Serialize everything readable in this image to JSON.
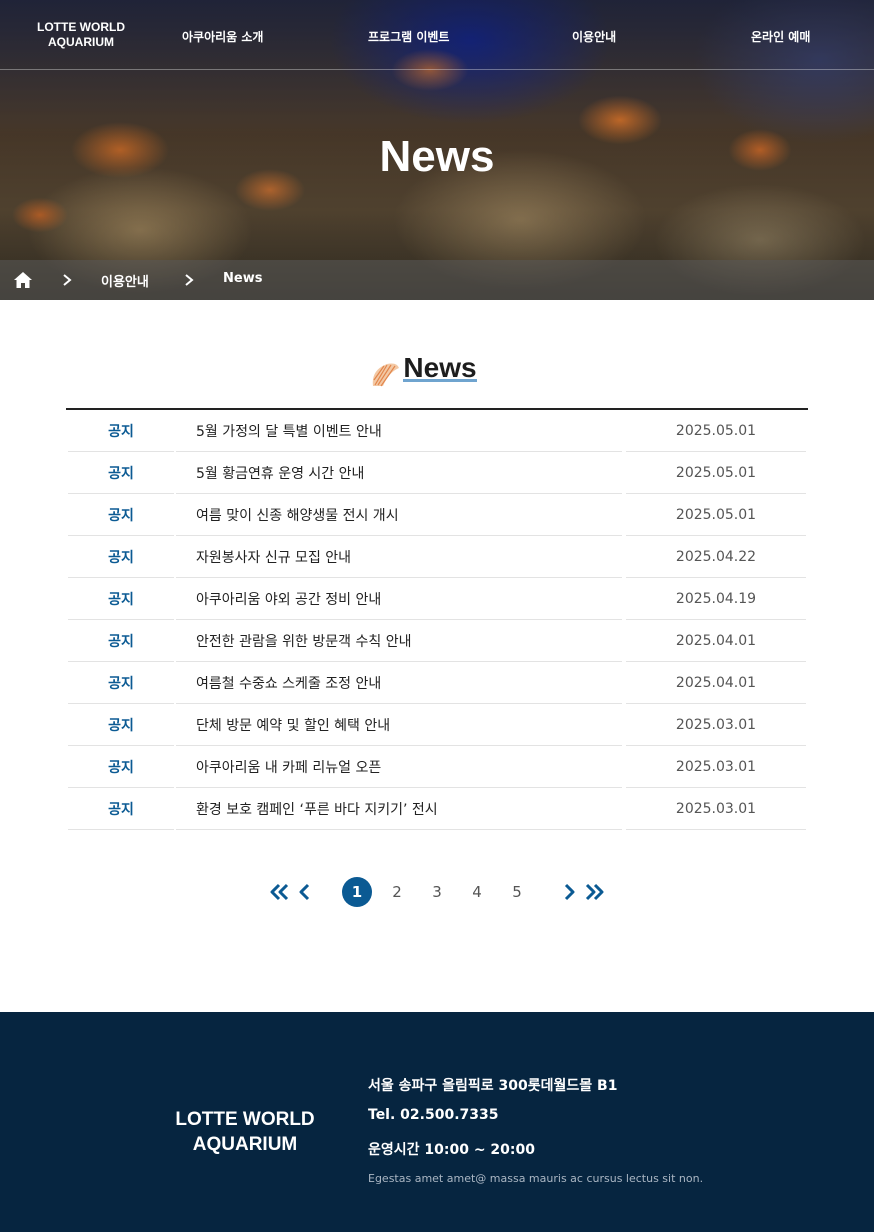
{
  "brand": {
    "logo_line1": "LOTTE WORLD",
    "logo_line2": "AQUARIUM"
  },
  "nav": {
    "items": [
      {
        "label": "아쿠아리움 소개"
      },
      {
        "label": "프로그램 이벤트"
      },
      {
        "label": "이용안내"
      },
      {
        "label": "온라인 예매"
      }
    ]
  },
  "hero": {
    "title": "News"
  },
  "breadcrumb": {
    "home_icon": "home-icon",
    "items": [
      "이용안내",
      "News"
    ]
  },
  "section": {
    "title": "News",
    "icon": "shell-icon"
  },
  "news": {
    "rows": [
      {
        "category": "공지",
        "title": "5월 가정의 달 특별 이벤트 안내",
        "date": "2025.05.01"
      },
      {
        "category": "공지",
        "title": "5월 황금연휴 운영 시간 안내",
        "date": "2025.05.01"
      },
      {
        "category": "공지",
        "title": "여름 맞이 신종 해양생물 전시 개시",
        "date": "2025.05.01"
      },
      {
        "category": "공지",
        "title": "자원봉사자 신규 모집 안내",
        "date": "2025.04.22"
      },
      {
        "category": "공지",
        "title": "아쿠아리움 야외 공간 정비 안내",
        "date": "2025.04.19"
      },
      {
        "category": "공지",
        "title": "안전한 관람을 위한 방문객 수칙 안내",
        "date": "2025.04.01"
      },
      {
        "category": "공지",
        "title": "여름철 수중쇼 스케줄 조정 안내",
        "date": "2025.04.01"
      },
      {
        "category": "공지",
        "title": "단체 방문 예약 및 할인 혜택 안내",
        "date": "2025.03.01"
      },
      {
        "category": "공지",
        "title": "아쿠아리움 내 카페 리뉴얼 오픈",
        "date": "2025.03.01"
      },
      {
        "category": "공지",
        "title": "환경 보호 캠페인 ‘푸른 바다 지키기’ 전시",
        "date": "2025.03.01"
      }
    ]
  },
  "pagination": {
    "pages": [
      "1",
      "2",
      "3",
      "4",
      "5"
    ],
    "current_page": 1,
    "icons": [
      "first-page-icon",
      "prev-page-icon",
      "next-page-icon",
      "last-page-icon"
    ]
  },
  "footer": {
    "logo_line1": "LOTTE WORLD",
    "logo_line2": "AQUARIUM",
    "address": "서울 송파구 올림픽로 300롯데월드몰 B1",
    "tel": "Tel. 02.500.7335",
    "hours": "운영시간 10:00 ~ 20:00",
    "tagline": "Egestas amet amet@ massa mauris ac cursus lectus sit non."
  },
  "colors": {
    "accent": "#0b5a93",
    "footer_bg": "#062540",
    "underline": "#6fa4cf"
  }
}
